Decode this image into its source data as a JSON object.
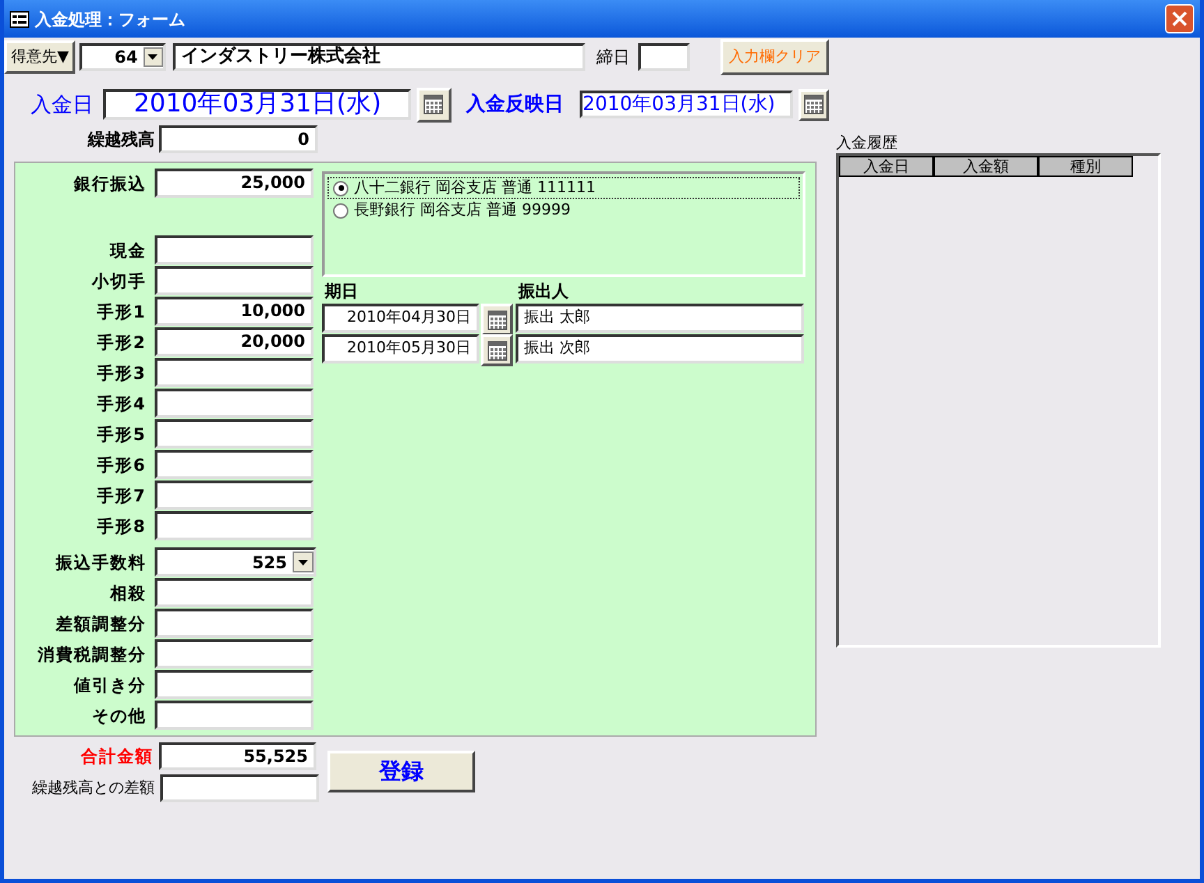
{
  "window": {
    "title": "入金処理：フォーム"
  },
  "customer": {
    "button": "得意先▼",
    "code": "64",
    "name": "インダストリー株式会社"
  },
  "closing_day": {
    "label": "締日"
  },
  "clear_button": "入力欄クリア",
  "deposit_date": {
    "label": "入金日",
    "value": "2010年03月31日(水)"
  },
  "reflect_date": {
    "label": "入金反映日",
    "value": "2010年03月31日(水)"
  },
  "carryover": {
    "label": "繰越残高",
    "value": "0"
  },
  "amounts": [
    {
      "label": "銀行振込",
      "value": "25,000",
      "kind": "field"
    },
    {
      "label": "現金",
      "kind": "field"
    },
    {
      "label": "小切手",
      "kind": "field"
    },
    {
      "label": "手形1",
      "value": "10,000",
      "kind": "field"
    },
    {
      "label": "手形2",
      "value": "20,000",
      "kind": "field"
    },
    {
      "label": "手形3",
      "kind": "field"
    },
    {
      "label": "手形4",
      "kind": "field"
    },
    {
      "label": "手形5",
      "kind": "field"
    },
    {
      "label": "手形6",
      "kind": "field"
    },
    {
      "label": "手形7",
      "kind": "field"
    },
    {
      "label": "手形8",
      "kind": "field"
    },
    {
      "label": "振込手数料",
      "value": "525",
      "kind": "dropdown"
    },
    {
      "label": "相殺",
      "kind": "field"
    },
    {
      "label": "差額調整分",
      "kind": "field"
    },
    {
      "label": "消費税調整分",
      "kind": "field"
    },
    {
      "label": "値引き分",
      "kind": "field"
    },
    {
      "label": "その他",
      "kind": "field"
    }
  ],
  "bank_accounts": [
    {
      "label": "八十二銀行 岡谷支店 普通 111111",
      "selected": true
    },
    {
      "label": "長野銀行 岡谷支店 普通 99999",
      "selected": false
    }
  ],
  "bills": {
    "columns": [
      "期日",
      "振出人"
    ],
    "rows": [
      {
        "date": "2010年04月30日",
        "drawer": "振出  太郎"
      },
      {
        "date": "2010年05月30日",
        "drawer": "振出  次郎"
      }
    ]
  },
  "history": {
    "label": "入金履歴",
    "columns": [
      "入金日",
      "入金額",
      "種別"
    ]
  },
  "total": {
    "label": "合計金額",
    "value": "55,525"
  },
  "difference": {
    "label": "繰越残高との差額"
  },
  "register_button": "登録"
}
